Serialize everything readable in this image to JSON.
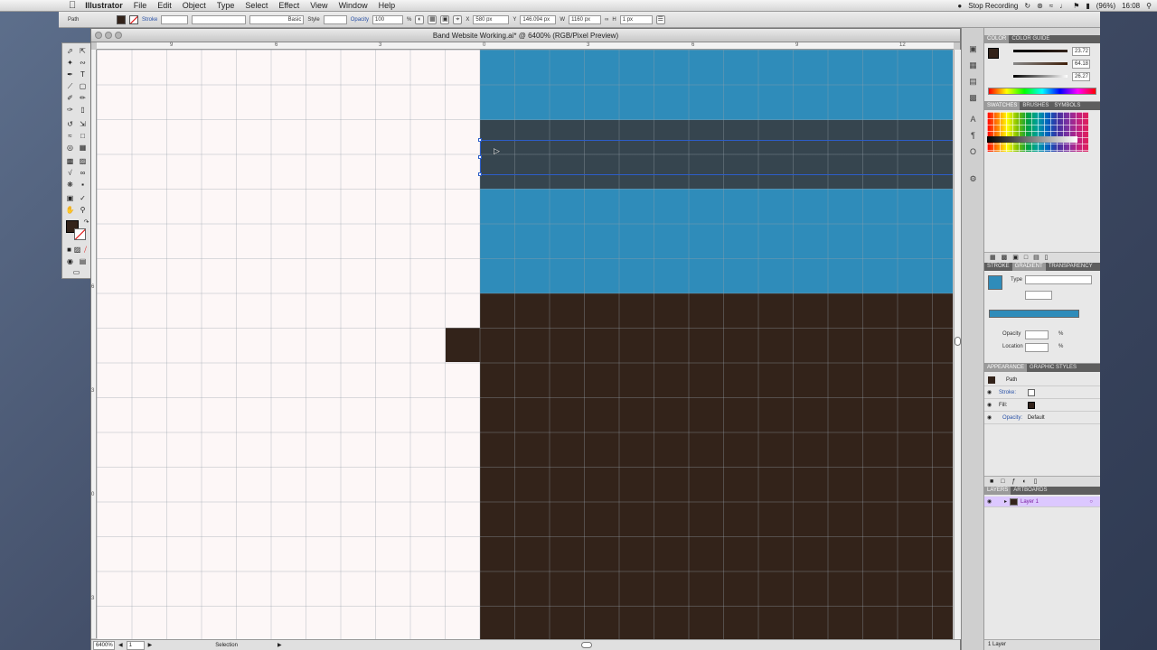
{
  "menubar": {
    "app_name": "Illustrator",
    "items": [
      "File",
      "Edit",
      "Object",
      "Type",
      "Select",
      "Effect",
      "View",
      "Window",
      "Help"
    ],
    "recording": "Stop Recording",
    "battery": "(96%)",
    "time": "16:08"
  },
  "control_bar": {
    "selection_type": "Path",
    "stroke_label": "Stroke",
    "brush_label": "Basic",
    "style_label": "Style",
    "opacity_label": "Opacity",
    "opacity_value": "100",
    "opacity_unit": "%",
    "x_label": "X",
    "x_value": "580 px",
    "y_label": "Y",
    "y_value": "146.094 px",
    "w_label": "W",
    "w_value": "1160 px",
    "h_label": "H",
    "h_value": "1 px"
  },
  "document": {
    "title": "Band Website Working.ai* @ 6400% (RGB/Pixel Preview)"
  },
  "rulers": {
    "h": [
      "9",
      "6",
      "3",
      "0",
      "3",
      "6",
      "9",
      "12"
    ],
    "v": [
      "6",
      "3",
      "0",
      "3",
      "6"
    ]
  },
  "status": {
    "zoom": "6400%",
    "page": "1",
    "tool": "Selection"
  },
  "colors": {
    "blue": "#2f8cba",
    "dark_gray": "#36454f",
    "brown": "#33231a",
    "guide": "#2d5dc8"
  },
  "color_panel": {
    "tabs": [
      "Color",
      "Color Guide"
    ],
    "r": "23.72",
    "g": "64.18",
    "b": "26.27"
  },
  "swatches_panel": {
    "tabs": [
      "Swatches",
      "Brushes",
      "Symbols"
    ]
  },
  "gradient_panel": {
    "tabs": [
      "Stroke",
      "Gradient",
      "Transparency"
    ],
    "type_label": "Type",
    "opacity_label": "Opacity",
    "location_label": "Location",
    "unit": "%"
  },
  "appearance_panel": {
    "tabs": [
      "Appearance",
      "Graphic Styles"
    ],
    "object": "Path",
    "stroke_label": "Stroke:",
    "fill_label": "Fill:",
    "opacity_label": "Opacity:",
    "opacity_value": "Default"
  },
  "layers_panel": {
    "tabs": [
      "Layers",
      "Artboards"
    ],
    "layer_name": "Layer 1",
    "count": "1 Layer"
  }
}
